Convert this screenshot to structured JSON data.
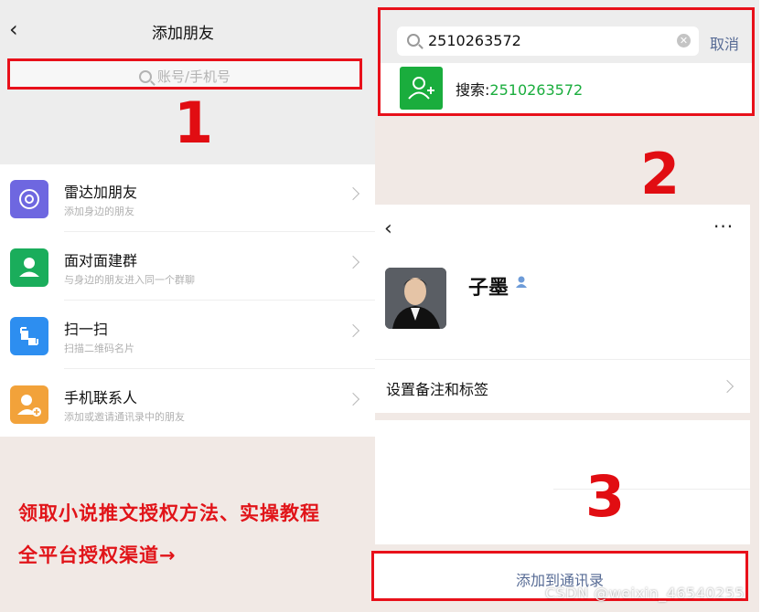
{
  "left": {
    "back_icon": "chevron-left-icon",
    "title": "添加朋友",
    "search_placeholder": "账号/手机号",
    "step": "1",
    "items": [
      {
        "icon": "radar-icon",
        "color": "#6e67e0",
        "name": "雷达加朋友",
        "sub": "添加身边的朋友"
      },
      {
        "icon": "group-icon",
        "color": "#1aad5b",
        "name": "面对面建群",
        "sub": "与身边的朋友进入同一个群聊"
      },
      {
        "icon": "scan-icon",
        "color": "#2d8ef0",
        "name": "扫一扫",
        "sub": "扫描二维码名片"
      },
      {
        "icon": "contact-add-icon",
        "color": "#f2a23a",
        "name": "手机联系人",
        "sub": "添加或邀请通讯录中的朋友"
      }
    ],
    "promo_line1": "领取小说推文授权方法、实操教程",
    "promo_line2": "全平台授权渠道→"
  },
  "right": {
    "search_value": "2510263572",
    "cancel": "取消",
    "result_prefix": "搜索:",
    "result_query": "2510263572",
    "step2": "2",
    "profile_name": "子墨",
    "profile_row": "设置备注和标签",
    "more": "···",
    "step3": "3",
    "add_button": "添加到通讯录"
  },
  "watermark": "CSDN @weixin_46540255"
}
